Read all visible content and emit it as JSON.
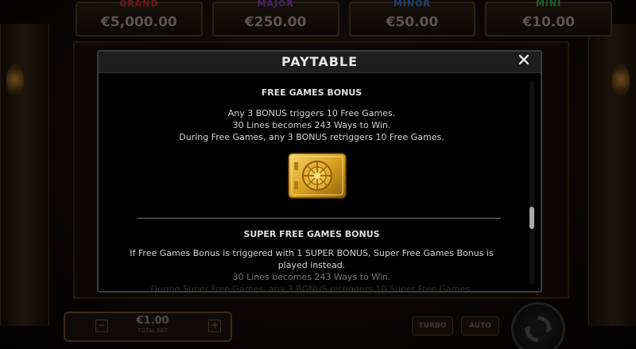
{
  "jackpots": [
    {
      "name": "GRAND",
      "amount": "€5,000.00",
      "color": "#8a1d1d"
    },
    {
      "name": "MAJOR",
      "amount": "€250.00",
      "color": "#5a2a80"
    },
    {
      "name": "MINOR",
      "amount": "€50.00",
      "color": "#1d4f8a"
    },
    {
      "name": "MINI",
      "amount": "€10.00",
      "color": "#1d7a2c"
    }
  ],
  "bet": {
    "value": "€1.00",
    "caption": "TOTAL BET",
    "minus": "−",
    "plus": "+"
  },
  "controls": {
    "turbo": "TURBO",
    "auto": "AUTO"
  },
  "modal": {
    "title": "PAYTABLE",
    "close": "✕",
    "free_games": {
      "title": "FREE GAMES BONUS",
      "lines": [
        "Any 3 BONUS triggers 10 Free Games.",
        "30 Lines becomes 243 Ways to Win.",
        "During Free Games, any 3 BONUS retriggers 10 Free Games."
      ]
    },
    "super_free_games": {
      "title": "SUPER FREE GAMES BONUS",
      "lines": [
        "If Free Games Bonus is triggered with 1 SUPER BONUS, Super Free Games Bonus is",
        "played instead.",
        "30 Lines becomes 243 Ways to Win.",
        "During Super Free Games, any 3 BONUS retriggers 10 Super Free Games."
      ]
    },
    "scroll_position": 0.62
  },
  "colors": {
    "accent_gold": "#d9a21f",
    "modal_bg": "#000000",
    "header_bg": "#1e1e1e"
  }
}
